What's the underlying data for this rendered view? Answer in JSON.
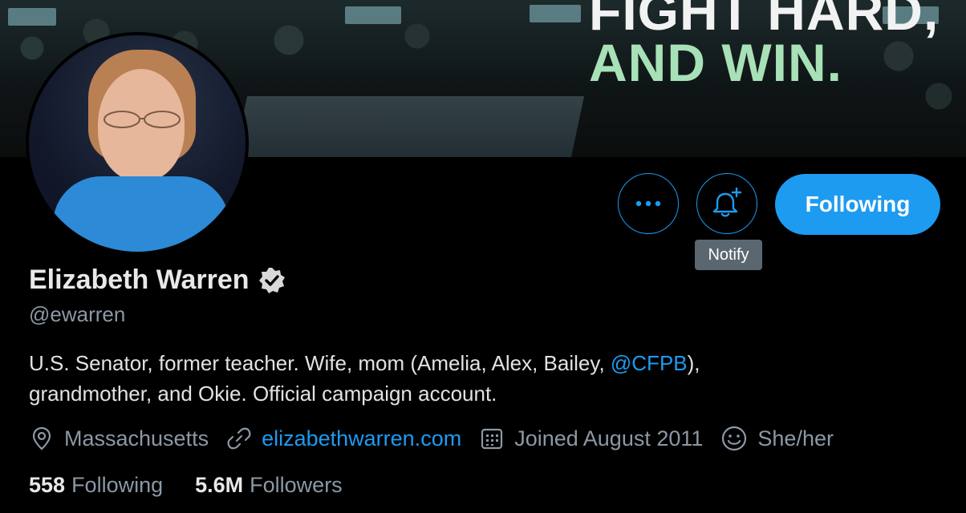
{
  "banner": {
    "line1": "FIGHT HARD,",
    "line2": "AND WIN."
  },
  "actions": {
    "more_icon": "more-horizontal-icon",
    "notify_icon": "bell-plus-icon",
    "notify_tooltip": "Notify",
    "following_label": "Following"
  },
  "profile": {
    "name": "Elizabeth Warren",
    "verified_icon": "verified-badge-icon",
    "handle": "@ewarren",
    "bio_part1": "U.S. Senator, former teacher. Wife, mom (Amelia, Alex, Bailey, ",
    "bio_mention": "@CFPB",
    "bio_part2": "),",
    "bio_line2": "grandmother, and Okie.  Official campaign account."
  },
  "meta": {
    "location_icon": "location-pin-icon",
    "location": "Massachusetts",
    "link_icon": "link-icon",
    "website": "elizabethwarren.com",
    "calendar_icon": "calendar-icon",
    "joined": "Joined August 2011",
    "pronouns_icon": "smiley-icon",
    "pronouns": "She/her"
  },
  "stats": {
    "following_count": "558",
    "following_label": "Following",
    "followers_count": "5.6M",
    "followers_label": "Followers"
  },
  "colors": {
    "accent": "#1d9bf0",
    "background": "#000000",
    "muted_text": "#8b98a5"
  }
}
